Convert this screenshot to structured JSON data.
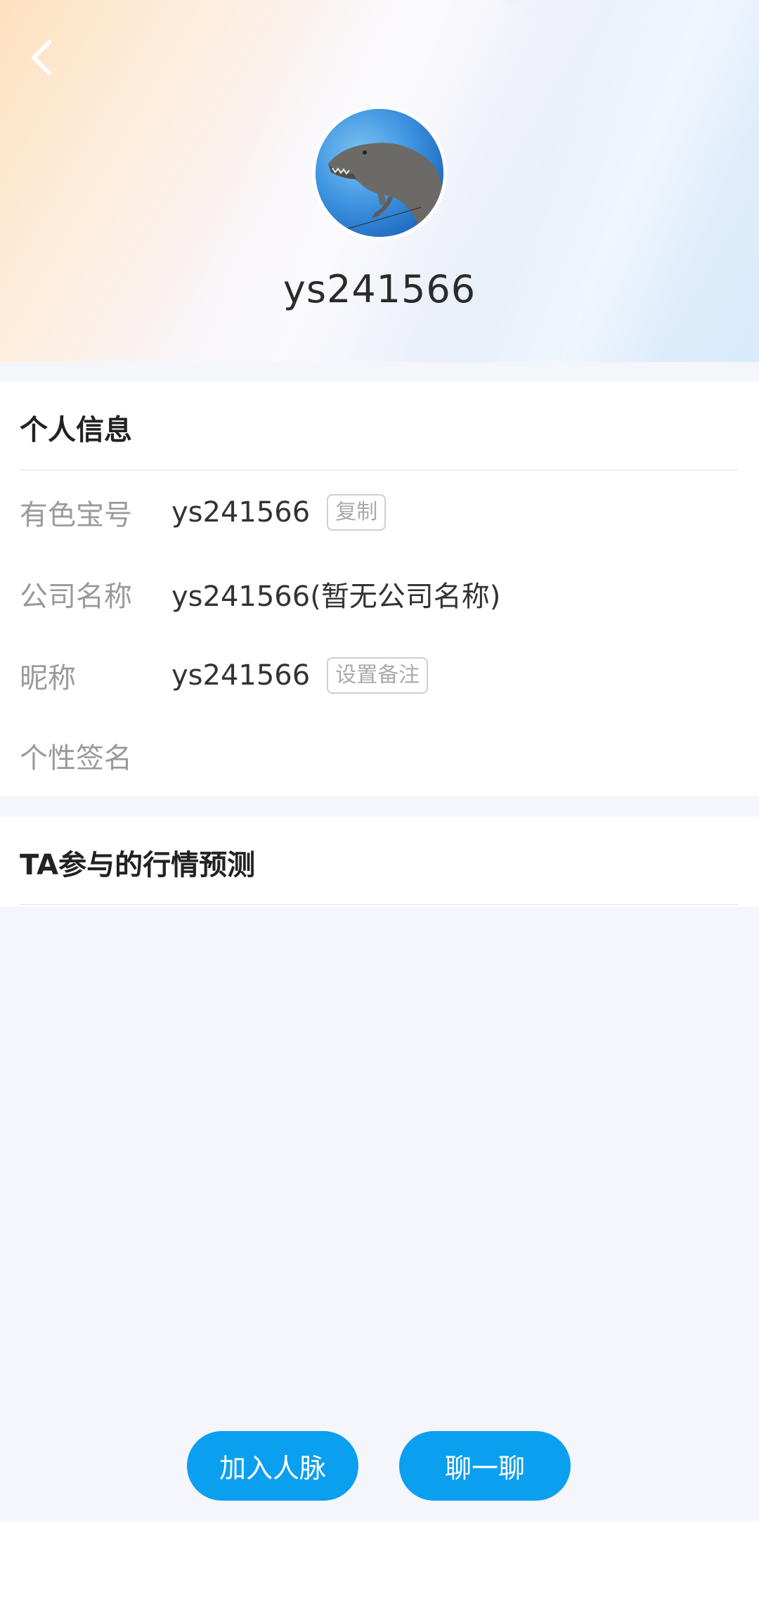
{
  "header": {
    "back_icon": "chevron-left-icon",
    "username": "ys241566"
  },
  "personal_info": {
    "title": "个人信息",
    "rows": [
      {
        "label": "有色宝号",
        "value": "ys241566",
        "action": "复制"
      },
      {
        "label": "公司名称",
        "value": "ys241566(暂无公司名称)"
      },
      {
        "label": "昵称",
        "value": "ys241566",
        "action": "设置备注"
      },
      {
        "label": "个性签名",
        "value": ""
      }
    ]
  },
  "predictions": {
    "title": "TA参与的行情预测"
  },
  "actions": {
    "add_contact": "加入人脉",
    "chat": "聊一聊"
  },
  "colors": {
    "primary_button": "#0b9ff0",
    "background_grey": "#f5f6fb"
  }
}
